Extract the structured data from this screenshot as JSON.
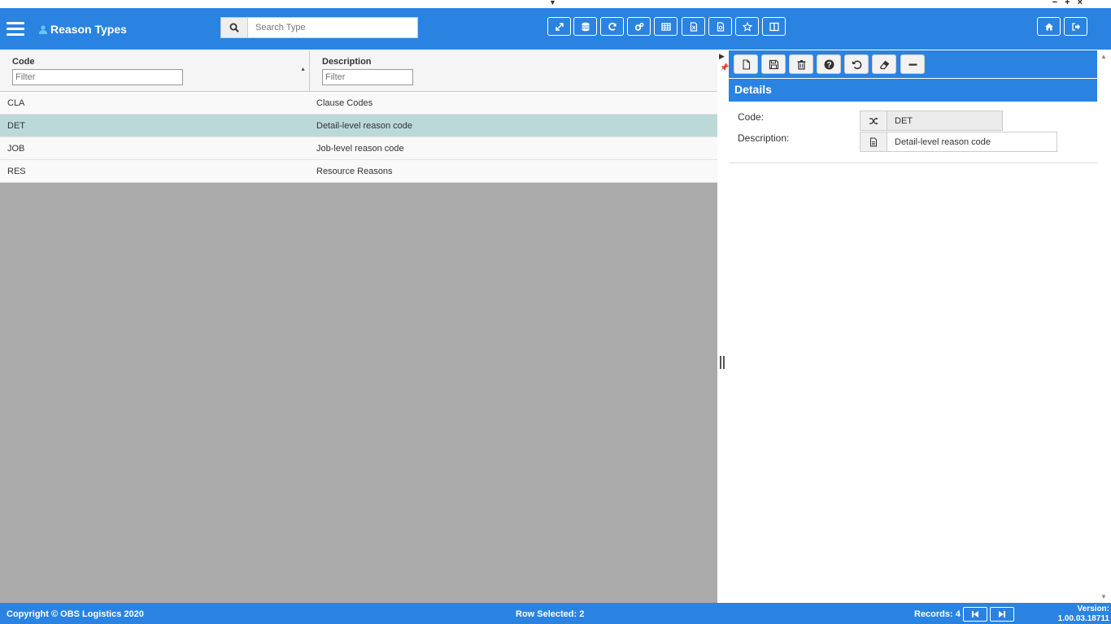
{
  "window": {
    "collapse_glyph": "▼",
    "controls": "− + ×"
  },
  "header": {
    "title": "Reason Types",
    "search_placeholder": "Search Type",
    "toolbar_icons": [
      "expand-icon",
      "database-icon",
      "refresh-icon",
      "settings-cogs-icon",
      "table-icon",
      "export-excel-icon",
      "export-pdf-icon",
      "favorite-star-icon",
      "columns-icon"
    ],
    "right_icons": [
      "home-icon",
      "logout-icon"
    ]
  },
  "grid": {
    "columns": [
      {
        "label": "Code",
        "filter_placeholder": "Filter"
      },
      {
        "label": "Description",
        "filter_placeholder": "Filter"
      }
    ],
    "rows": [
      {
        "code": "CLA",
        "description": "Clause Codes"
      },
      {
        "code": "DET",
        "description": "Detail-level reason code"
      },
      {
        "code": "JOB",
        "description": "Job-level reason code"
      },
      {
        "code": "RES",
        "description": "Resource Reasons"
      }
    ],
    "selected_index": 1
  },
  "detail": {
    "toolbar_icons": [
      "new-document-icon",
      "save-icon",
      "delete-icon",
      "help-icon",
      "undo-icon",
      "eraser-icon",
      "minus-icon"
    ],
    "heading": "Details",
    "fields": [
      {
        "label": "Code:",
        "value": "DET",
        "icon": "shuffle-icon"
      },
      {
        "label": "Description:",
        "value": "Detail-level reason code",
        "icon": "document-icon"
      }
    ]
  },
  "footer": {
    "copyright": "Copyright © OBS Logistics 2020",
    "row_selected": "Row Selected: 2",
    "records": "Records: 4",
    "version_label": "Version:",
    "version": "1.00.03.18711"
  },
  "colors": {
    "accent": "#2a83e0",
    "selected_row": "#bcd9d9",
    "grid_empty": "#aaaaaa"
  }
}
